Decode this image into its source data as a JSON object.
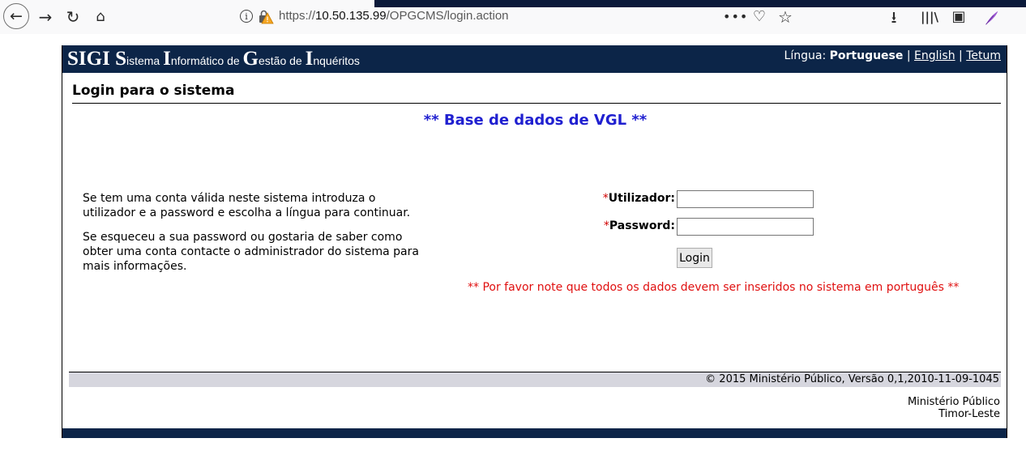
{
  "browser": {
    "url_prefix": "https://",
    "url_host": "10.50.135.99",
    "url_path": "/OPGCMS/login.action",
    "icons": {
      "back": "←",
      "forward": "→",
      "reload": "↻",
      "home": "⌂",
      "info": "i",
      "page_actions": "•••",
      "pocket": "♡",
      "bookmark": "☆",
      "downloads": "⭳",
      "library": "|||\\",
      "sidebar": "▣"
    }
  },
  "app": {
    "title_parts": [
      {
        "big": "SIGI ",
        "small": ""
      },
      {
        "big": "S",
        "small": "istema "
      },
      {
        "big": "I",
        "small": "nformático de "
      },
      {
        "big": "G",
        "small": "estão de "
      },
      {
        "big": "I",
        "small": "nquéritos"
      }
    ],
    "language": {
      "label": "Língua: ",
      "current": "Portuguese",
      "separator": " | ",
      "options": [
        "English",
        "Tetum"
      ]
    },
    "page_heading": "Login para o sistema",
    "db_banner": "** Base de dados de VGL **",
    "help_paragraphs": [
      "Se tem uma conta válida neste sistema introduza o utilizador e a password e escolha a língua para continuar.",
      "Se esqueceu a sua password ou gostaria de saber como obter uma conta contacte o administrador do sistema para mais informações."
    ],
    "form": {
      "required_marker": "*",
      "username_label": "Utilizador:",
      "username_value": "",
      "password_label": "Password:",
      "password_value": "",
      "login_button": "Login"
    },
    "notice": "** Por favor note que todos os dados devem ser inseridos no sistema em português **",
    "footer": {
      "copyright": "© 2015 Ministério Público, Versão 0,1,2010-11-09-1045",
      "org_line1": "Ministério Público",
      "org_line2": "Timor-Leste"
    }
  },
  "colors": {
    "header_bg": "#0c2548",
    "banner_text": "#2020d0",
    "notice_text": "#e01010",
    "footer_bg": "#d6d6de"
  }
}
